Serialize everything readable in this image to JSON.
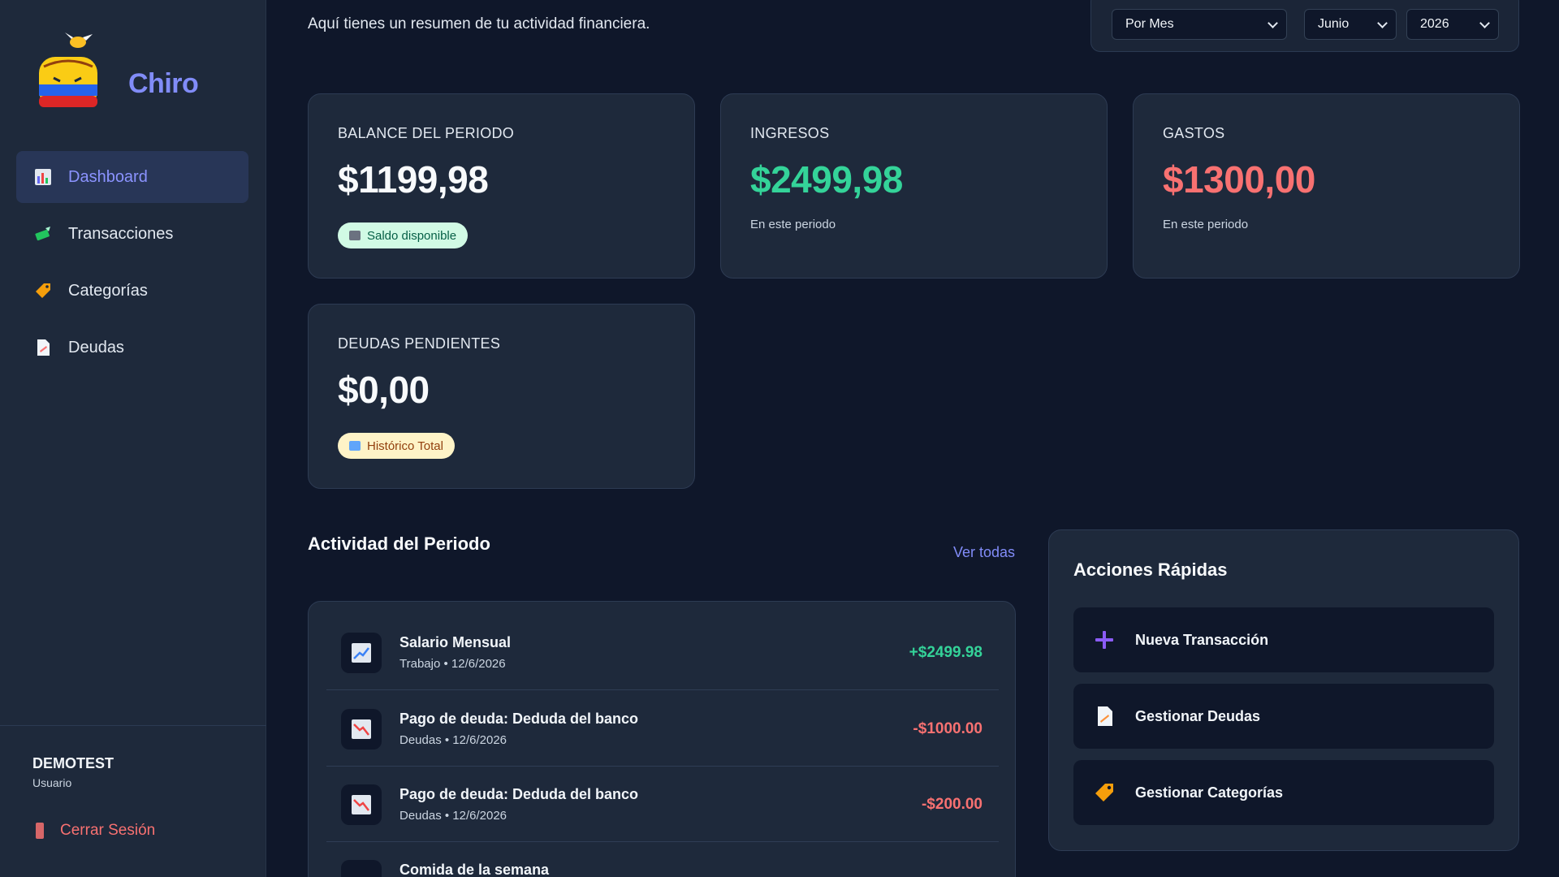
{
  "app": {
    "name": "Chiro"
  },
  "sidebar": {
    "items": [
      {
        "label": "Dashboard",
        "icon": "bar-chart-icon"
      },
      {
        "label": "Transacciones",
        "icon": "money-icon"
      },
      {
        "label": "Categorías",
        "icon": "tag-icon"
      },
      {
        "label": "Deudas",
        "icon": "document-icon"
      }
    ],
    "user": {
      "name": "DEMOTEST",
      "role": "Usuario"
    },
    "logout_label": "Cerrar Sesión"
  },
  "header": {
    "subtitle": "Aquí tienes un resumen de tu actividad financiera.",
    "filters": {
      "period": "Por Mes",
      "month": "Junio",
      "year": "2026"
    }
  },
  "cards": {
    "balance": {
      "title": "BALANCE DEL PERIODO",
      "amount": "$1199,98",
      "badge": "Saldo disponible"
    },
    "ingresos": {
      "title": "INGRESOS",
      "amount": "$2499,98",
      "note": "En este periodo"
    },
    "gastos": {
      "title": "GASTOS",
      "amount": "$1300,00",
      "note": "En este periodo"
    },
    "deudas": {
      "title": "DEUDAS PENDIENTES",
      "amount": "$0,00",
      "badge": "Histórico Total"
    }
  },
  "activity": {
    "title": "Actividad del Periodo",
    "see_all": "Ver todas",
    "rows": [
      {
        "title": "Salario Mensual",
        "sub": "Trabajo • 12/6/2026",
        "amount": "+$2499.98"
      },
      {
        "title": "Pago de deuda: Deduda del banco",
        "sub": "Deudas • 12/6/2026",
        "amount": "-$1000.00"
      },
      {
        "title": "Pago de deuda: Deduda del banco",
        "sub": "Deudas • 12/6/2026",
        "amount": "-$200.00"
      },
      {
        "title": "Comida de la semana",
        "sub": "",
        "amount": ""
      }
    ]
  },
  "quick_actions": {
    "title": "Acciones Rápidas",
    "items": [
      {
        "label": "Nueva Transacción"
      },
      {
        "label": "Gestionar Deudas"
      },
      {
        "label": "Gestionar Categorías"
      }
    ]
  },
  "colors": {
    "accent": "#818cf8",
    "positive": "#34d399",
    "negative": "#f87171",
    "background": "#0f172a",
    "surface": "#1e293b"
  }
}
